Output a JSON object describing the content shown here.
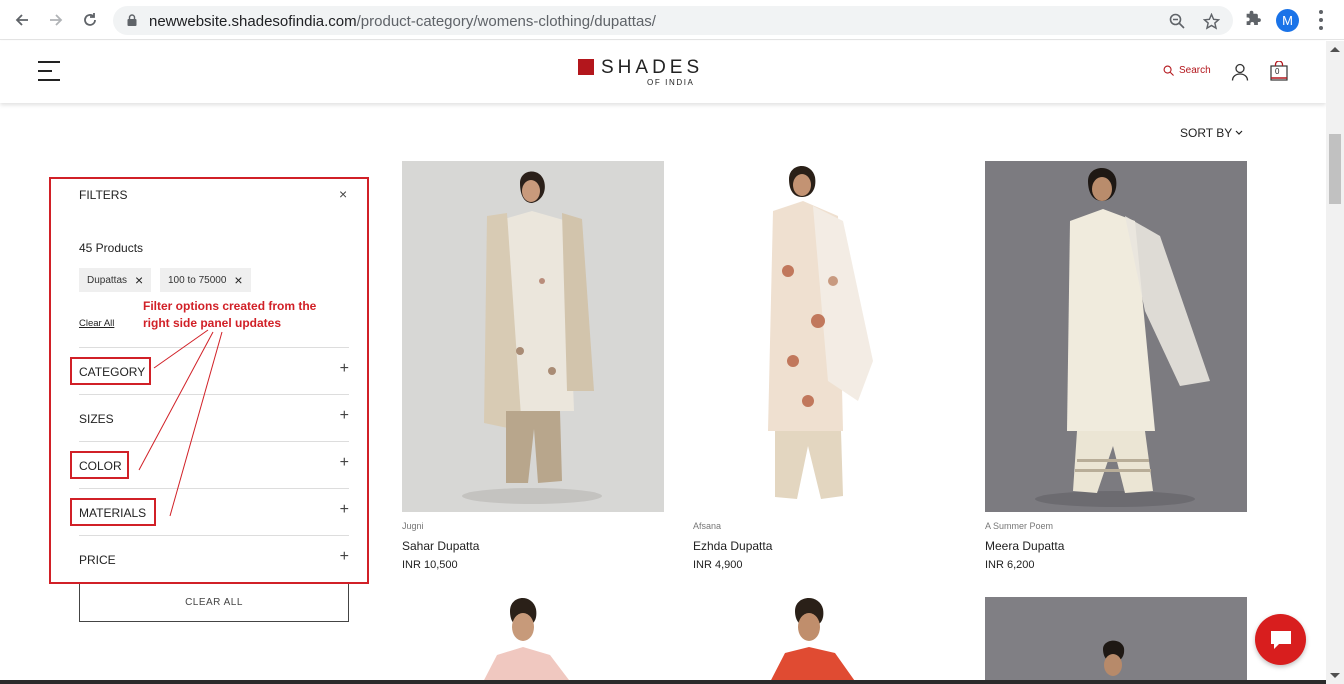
{
  "browser": {
    "url_domain": "newwebsite.shadesofindia.com",
    "url_path": "/product-category/womens-clothing/dupattas/",
    "profile_initial": "M"
  },
  "header": {
    "logo_main": "SHADES",
    "logo_sub": "OF INDIA",
    "search_label": "Search",
    "cart_count": "0"
  },
  "sort": {
    "label": "SORT BY"
  },
  "filters": {
    "title": "FILTERS",
    "close": "×",
    "product_count": "45 Products",
    "chips": [
      {
        "label": "Dupattas"
      },
      {
        "label": "100 to 75000"
      }
    ],
    "clear_link": "Clear All",
    "groups": [
      {
        "label": "CATEGORY"
      },
      {
        "label": "SIZES"
      },
      {
        "label": "COLOR"
      },
      {
        "label": "MATERIALS"
      },
      {
        "label": "PRICE"
      }
    ],
    "clear_all_button": "CLEAR ALL"
  },
  "annotation": {
    "text": "Filter options created from the right side panel updates",
    "color": "#d12027"
  },
  "products": [
    {
      "brand": "Jugni",
      "name": "Sahar Dupatta",
      "price": "INR 10,500"
    },
    {
      "brand": "Afsana",
      "name": "Ezhda Dupatta",
      "price": "INR 4,900"
    },
    {
      "brand": "A Summer Poem",
      "name": "Meera Dupatta",
      "price": "INR 6,200"
    }
  ],
  "colors": {
    "brand_red": "#b3161c",
    "annotation_red": "#d12027",
    "chat_red": "#d81e1e"
  }
}
